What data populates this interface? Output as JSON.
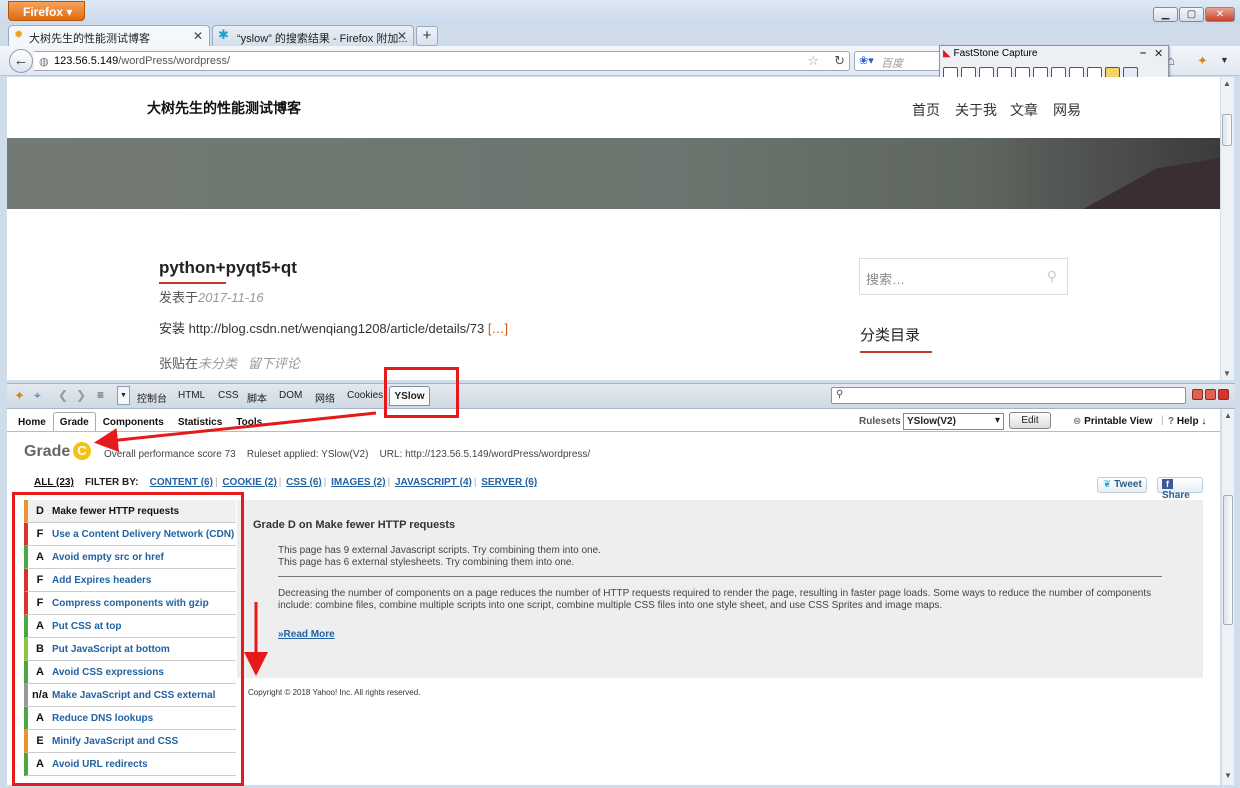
{
  "browser": {
    "menu_button": "Firefox",
    "tabs": [
      {
        "title": "大树先生的性能测试博客"
      },
      {
        "title": "“yslow” 的搜索结果 - Firefox 附加..."
      }
    ],
    "url_host": "123.56.5.149",
    "url_path": "/wordPress/wordpress/",
    "search_placeholder": "百度"
  },
  "capture_tool": {
    "title": "FastStone Capture"
  },
  "site": {
    "name": "大树先生的性能测试博客",
    "menu": [
      "首页",
      "关于我",
      "文章",
      "网易"
    ],
    "post": {
      "title": "python+pyqt5+qt",
      "date_prefix": "发表于",
      "date": "2017-11-16",
      "body": "安装 http://blog.csdn.net/wenqiang1208/article/details/73",
      "more": "[…]",
      "foot_prefix": "张贴在",
      "category": "未分类",
      "comment": "留下评论"
    },
    "sidebar": {
      "search_placeholder": "搜索…",
      "category_title": "分类目录"
    }
  },
  "firebug": {
    "tabs": [
      "控制台",
      "HTML",
      "CSS",
      "脚本",
      "DOM",
      "网络",
      "Cookies",
      "YSlow"
    ]
  },
  "yslow": {
    "subtabs": [
      "Home",
      "Grade",
      "Components",
      "Statistics",
      "Tools"
    ],
    "rulesets_label": "Rulesets",
    "ruleset": "YSlow(V2)",
    "edit_label": "Edit",
    "printable_view": "Printable View",
    "help": "Help ↓",
    "grade_label": "Grade",
    "grade": "C",
    "overall_score": "Overall performance score 73",
    "ruleset_applied": "Ruleset applied: YSlow(V2)",
    "url_text": "URL: http://123.56.5.149/wordPress/wordpress/",
    "filter_all": "ALL (23)",
    "filter_by": "FILTER BY:",
    "filters": [
      "CONTENT (6)",
      "COOKIE (2)",
      "CSS (6)",
      "IMAGES (2)",
      "JAVASCRIPT (4)",
      "SERVER (6)"
    ],
    "tweet": "Tweet",
    "share": "Share",
    "rules": [
      {
        "grade": "D",
        "name": "Make fewer HTTP requests",
        "color": "#e8952f"
      },
      {
        "grade": "F",
        "name": "Use a Content Delivery Network (CDN)",
        "color": "#d9342b"
      },
      {
        "grade": "A",
        "name": "Avoid empty src or href",
        "color": "#4aa544"
      },
      {
        "grade": "F",
        "name": "Add Expires headers",
        "color": "#d9342b"
      },
      {
        "grade": "F",
        "name": "Compress components with gzip",
        "color": "#d9342b"
      },
      {
        "grade": "A",
        "name": "Put CSS at top",
        "color": "#4aa544"
      },
      {
        "grade": "B",
        "name": "Put JavaScript at bottom",
        "color": "#8cc63f"
      },
      {
        "grade": "A",
        "name": "Avoid CSS expressions",
        "color": "#4aa544"
      },
      {
        "grade": "n/a",
        "name": "Make JavaScript and CSS external",
        "color": "#999999"
      },
      {
        "grade": "A",
        "name": "Reduce DNS lookups",
        "color": "#4aa544"
      },
      {
        "grade": "E",
        "name": "Minify JavaScript and CSS",
        "color": "#e8952f"
      },
      {
        "grade": "A",
        "name": "Avoid URL redirects",
        "color": "#4aa544"
      }
    ],
    "detail": {
      "title": "Grade D on Make fewer HTTP requests",
      "line1": "This page has 9 external Javascript scripts. Try combining them into one.",
      "line2": "This page has 6 external stylesheets. Try combining them into one.",
      "description": "Decreasing the number of components on a page reduces the number of HTTP requests required to render the page, resulting in faster page loads. Some ways to reduce the number of components include: combine files, combine multiple scripts into one script, combine multiple CSS files into one style sheet, and use CSS Sprites and image maps.",
      "read_more": "»Read More"
    },
    "copyright": "Copyright © 2018 Yahoo! Inc. All rights reserved."
  }
}
